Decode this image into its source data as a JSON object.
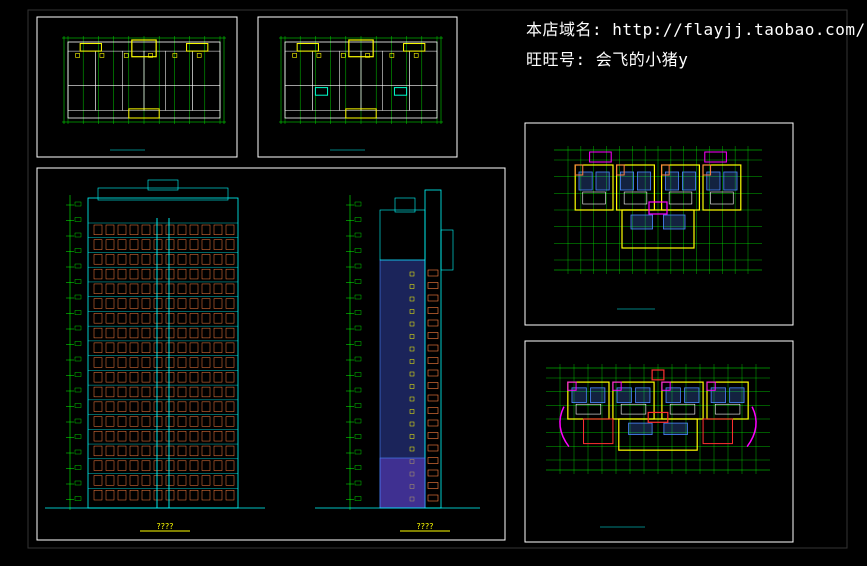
{
  "overlay": {
    "shop_url": "本店域名: http://flayjj.taobao.com/",
    "wangwang": "旺旺号: 会飞的小猪y"
  },
  "labels": {
    "front_elevation": "????",
    "side_elevation": "????"
  },
  "colors": {
    "background": "#000000",
    "outer_frame": "#1a1a1a",
    "sheet_border": "#ffffff",
    "grid": "#00cc00",
    "wall": "#ffff00",
    "window": "#00ffff",
    "furniture": "#ff00ff",
    "room": "#4a86ff",
    "dim": "#00ff00",
    "orange": "#ff8040",
    "red": "#ff3030"
  }
}
